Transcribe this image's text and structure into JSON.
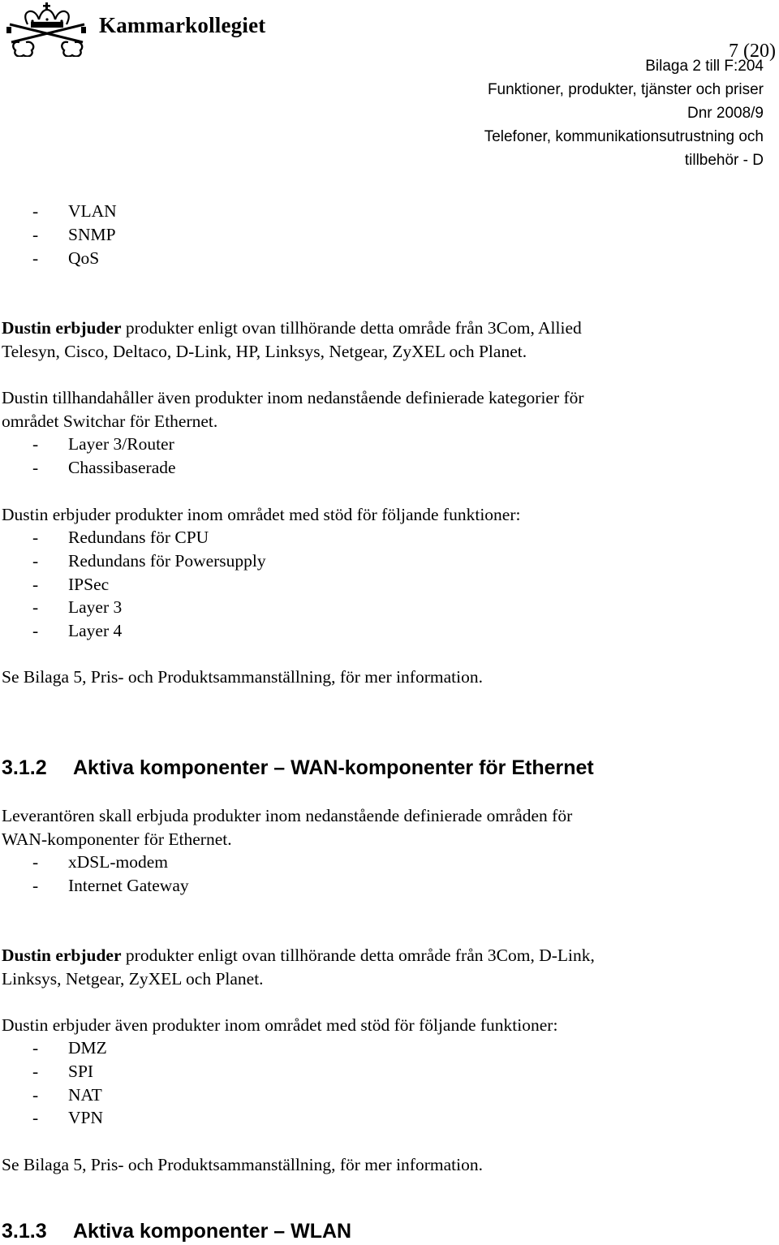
{
  "header": {
    "logo_name": "Kammarkollegiet",
    "logo_icon": "crown-keys-icon",
    "page_number": "7 (20)",
    "meta_lines": [
      "Bilaga 2 till F:204",
      "Funktioner, produkter, tjänster och priser",
      "Dnr 2008/9",
      "Telefoner, kommunikationsutrustning och",
      "tillbehör - D"
    ]
  },
  "list_top": {
    "bullet": "-",
    "items": [
      "VLAN",
      "SNMP",
      "QoS"
    ]
  },
  "para1": {
    "bold": "Dustin erbjuder",
    "line1_rest": " produkter enligt ovan tillhörande detta område från 3Com, Allied",
    "line2": "Telesyn, Cisco, Deltaco, D-Link, HP, Linksys, Netgear, ZyXEL och Planet."
  },
  "para2": {
    "line1": "Dustin tillhandahåller även produkter inom nedanstående definierade kategorier för",
    "line2": "området Switchar för Ethernet.",
    "items": [
      "Layer 3/Router",
      "Chassibaserade"
    ]
  },
  "para3": {
    "intro": "Dustin erbjuder produkter inom området med stöd för följande funktioner:",
    "items": [
      "Redundans för CPU",
      "Redundans för Powersupply",
      "IPSec",
      "Layer 3",
      "Layer 4"
    ]
  },
  "see_more_1": "Se Bilaga 5, Pris- och Produktsammanställning, för mer information.",
  "section_312": {
    "number": "3.1.2",
    "title": "Aktiva komponenter – WAN-komponenter för Ethernet",
    "intro_line1": "Leverantören skall erbjuda produkter inom nedanstående definierade områden för",
    "intro_line2": "WAN-komponenter för Ethernet.",
    "items": [
      "xDSL-modem",
      "Internet Gateway"
    ],
    "offer_bold": "Dustin erbjuder",
    "offer_line1_rest": " produkter enligt ovan tillhörande detta område från 3Com, D-Link,",
    "offer_line2": "Linksys, Netgear, ZyXEL och Planet.",
    "functions_intro": "Dustin erbjuder även produkter inom området med stöd för följande funktioner:",
    "functions": [
      "DMZ",
      "SPI",
      "NAT",
      "VPN"
    ],
    "see_more": "Se Bilaga 5, Pris- och Produktsammanställning, för mer information."
  },
  "section_313": {
    "number": "3.1.3",
    "title": "Aktiva komponenter – WLAN"
  }
}
